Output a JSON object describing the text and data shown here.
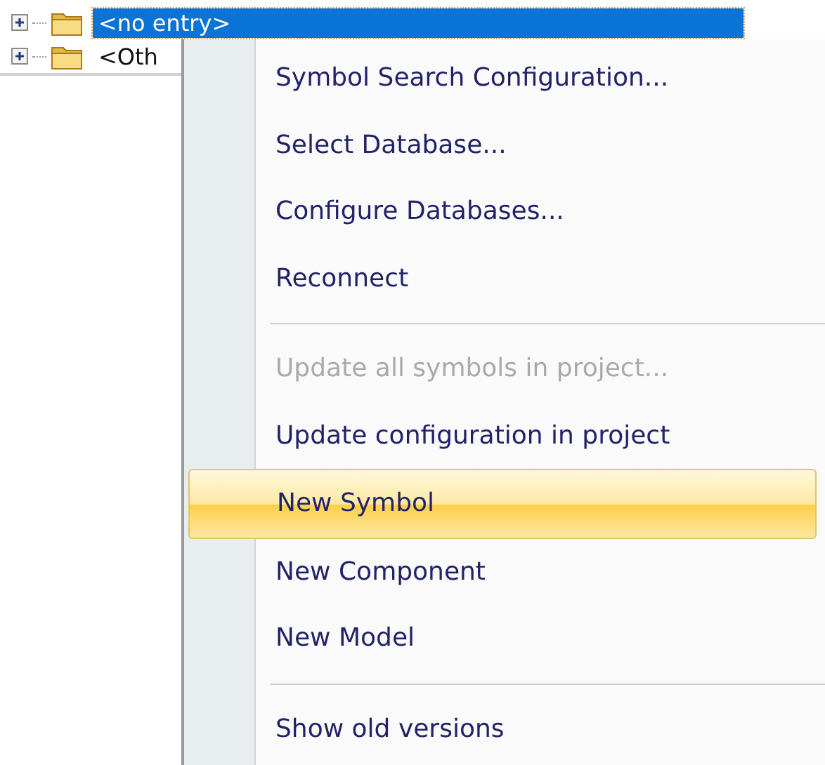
{
  "tree": [
    {
      "label": "<no entry>",
      "selected": true
    },
    {
      "label": "<Oth",
      "selected": false
    }
  ],
  "menu": [
    {
      "kind": "item",
      "label": "Symbol Search Configuration...",
      "disabled": false,
      "selected": false
    },
    {
      "kind": "item",
      "label": "Select Database...",
      "disabled": false,
      "selected": false
    },
    {
      "kind": "item",
      "label": "Configure Databases...",
      "disabled": false,
      "selected": false
    },
    {
      "kind": "item",
      "label": "Reconnect",
      "disabled": false,
      "selected": false
    },
    {
      "kind": "separator"
    },
    {
      "kind": "item",
      "label": "Update all symbols in project...",
      "disabled": true,
      "selected": false
    },
    {
      "kind": "item",
      "label": "Update configuration in project",
      "disabled": false,
      "selected": false
    },
    {
      "kind": "item",
      "label": "New Symbol",
      "disabled": false,
      "selected": true
    },
    {
      "kind": "item",
      "label": "New Component",
      "disabled": false,
      "selected": false
    },
    {
      "kind": "item",
      "label": "New Model",
      "disabled": false,
      "selected": false
    },
    {
      "kind": "separator"
    },
    {
      "kind": "item",
      "label": "Show old versions",
      "disabled": false,
      "selected": false
    }
  ]
}
